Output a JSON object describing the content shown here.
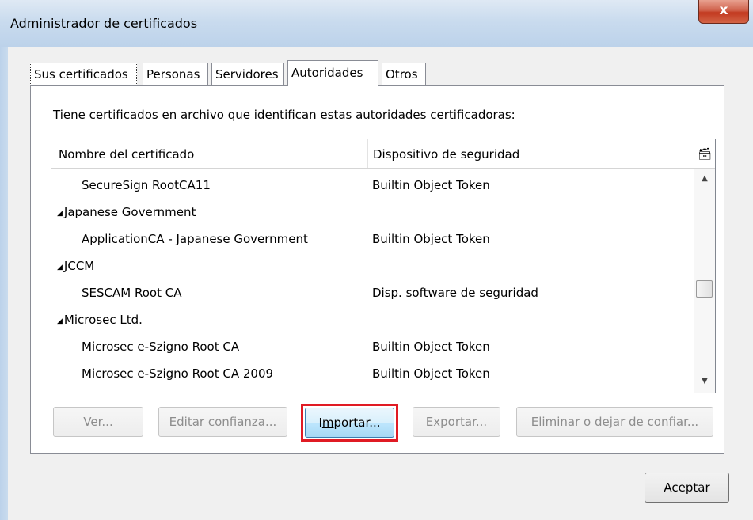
{
  "window": {
    "title": "Administrador de certificados",
    "close_glyph": "x"
  },
  "tabs": [
    {
      "label": "Sus certificados"
    },
    {
      "label": "Personas"
    },
    {
      "label": "Servidores"
    },
    {
      "label": "Autoridades",
      "active": true
    },
    {
      "label": "Otros"
    }
  ],
  "intro": "Tiene certificados en archivo que identifican estas autoridades certificadoras:",
  "table": {
    "columns": [
      "Nombre del certificado",
      "Dispositivo de seguridad"
    ],
    "column_picker_icon": "column-picker-icon",
    "rows": [
      {
        "type": "cert",
        "name": "SecureSign RootCA11",
        "device": "Builtin Object Token"
      },
      {
        "type": "group",
        "name": "Japanese Government",
        "expanded": true
      },
      {
        "type": "cert",
        "name": "ApplicationCA - Japanese Government",
        "device": "Builtin Object Token"
      },
      {
        "type": "group",
        "name": "JCCM",
        "expanded": true
      },
      {
        "type": "cert",
        "name": "SESCAM Root CA",
        "device": "Disp. software de seguridad"
      },
      {
        "type": "group",
        "name": "Microsec Ltd.",
        "expanded": true
      },
      {
        "type": "cert",
        "name": "Microsec e-Szigno Root CA",
        "device": "Builtin Object Token"
      },
      {
        "type": "cert",
        "name": "Microsec e-Szigno Root CA 2009",
        "device": "Builtin Object Token"
      }
    ]
  },
  "buttons": {
    "ver": {
      "label": "Ver...",
      "mnemonic": "V",
      "rest": "er...",
      "enabled": false
    },
    "editar": {
      "label": "Editar confianza...",
      "mnemonic": "E",
      "rest": "ditar confianza...",
      "enabled": false
    },
    "importar": {
      "label": "Importar...",
      "mnemonic": "m",
      "pre": "I",
      "rest": "portar...",
      "enabled": true,
      "highlighted": true
    },
    "exportar": {
      "label": "Exportar...",
      "mnemonic": "x",
      "pre": "E",
      "rest": "portar...",
      "enabled": false
    },
    "eliminar": {
      "label": "Eliminar o dejar de confiar...",
      "pre": "Elimi",
      "mnemonic": "n",
      "rest": "ar o dejar de confiar...",
      "enabled": false
    },
    "aceptar": {
      "label": "Aceptar",
      "enabled": true
    }
  },
  "colors": {
    "highlight": "#e01b24",
    "close_button": "#c2391f",
    "titlebar": "#c9dbee"
  }
}
